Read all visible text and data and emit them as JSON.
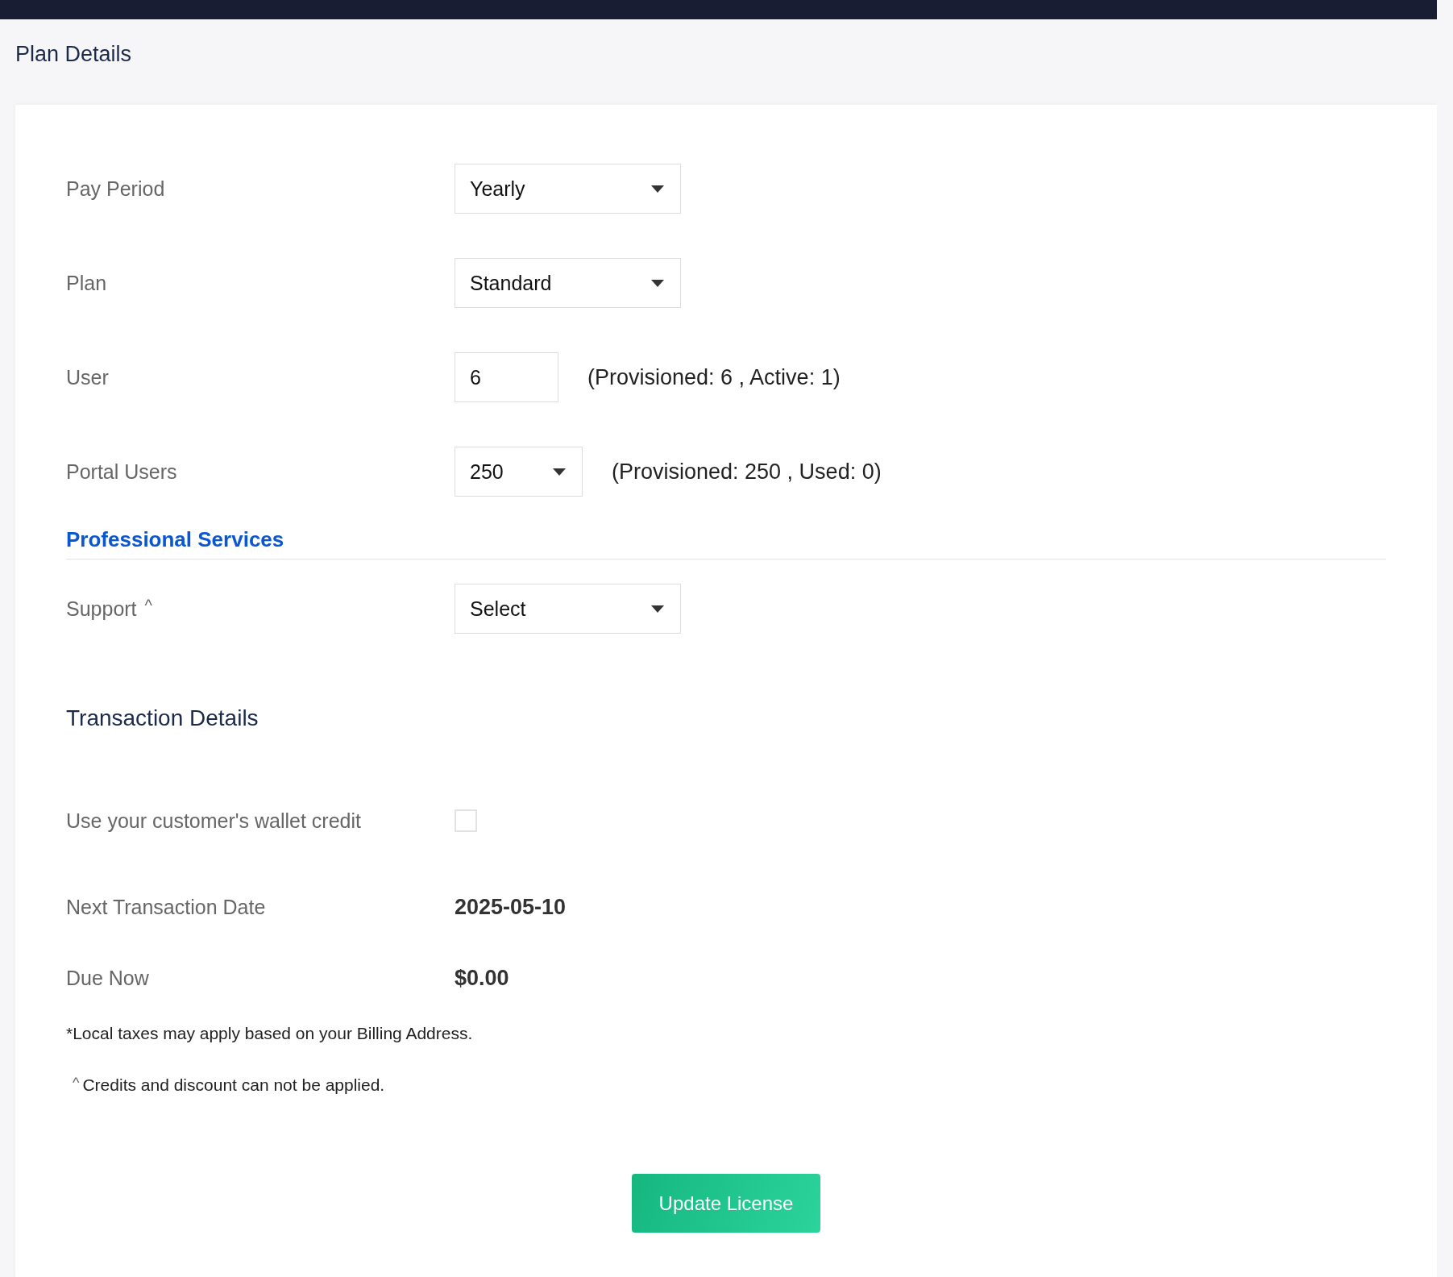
{
  "page": {
    "title": "Plan Details"
  },
  "plan_fields": [
    {
      "kind": "select",
      "label": "Pay Period",
      "value": "Yearly"
    },
    {
      "kind": "select",
      "label": "Plan",
      "value": "Standard"
    },
    {
      "kind": "input",
      "label": "User",
      "value": "6",
      "note": "(Provisioned: 6 , Active: 1)"
    },
    {
      "kind": "select",
      "label": "Portal Users",
      "value": "250",
      "note": "(Provisioned: 250 , Used: 0)"
    }
  ],
  "professional_services": {
    "heading": "Professional Services",
    "fields": [
      {
        "kind": "select",
        "label": "Support",
        "mark": "^",
        "value": "Select"
      }
    ]
  },
  "transaction": {
    "heading": "Transaction Details",
    "fields": [
      {
        "kind": "checkbox",
        "label": "Use your customer's wallet credit",
        "checked": false
      },
      {
        "kind": "value",
        "label": "Next Transaction Date",
        "value": "2025-05-10"
      },
      {
        "kind": "value",
        "label": "Due Now",
        "value": "$0.00"
      }
    ]
  },
  "footnotes": [
    {
      "text": "*Local taxes may apply based on your Billing Address."
    },
    {
      "mark": "^",
      "text": "Credits and discount can not be applied."
    }
  ],
  "update_button": "Update License"
}
